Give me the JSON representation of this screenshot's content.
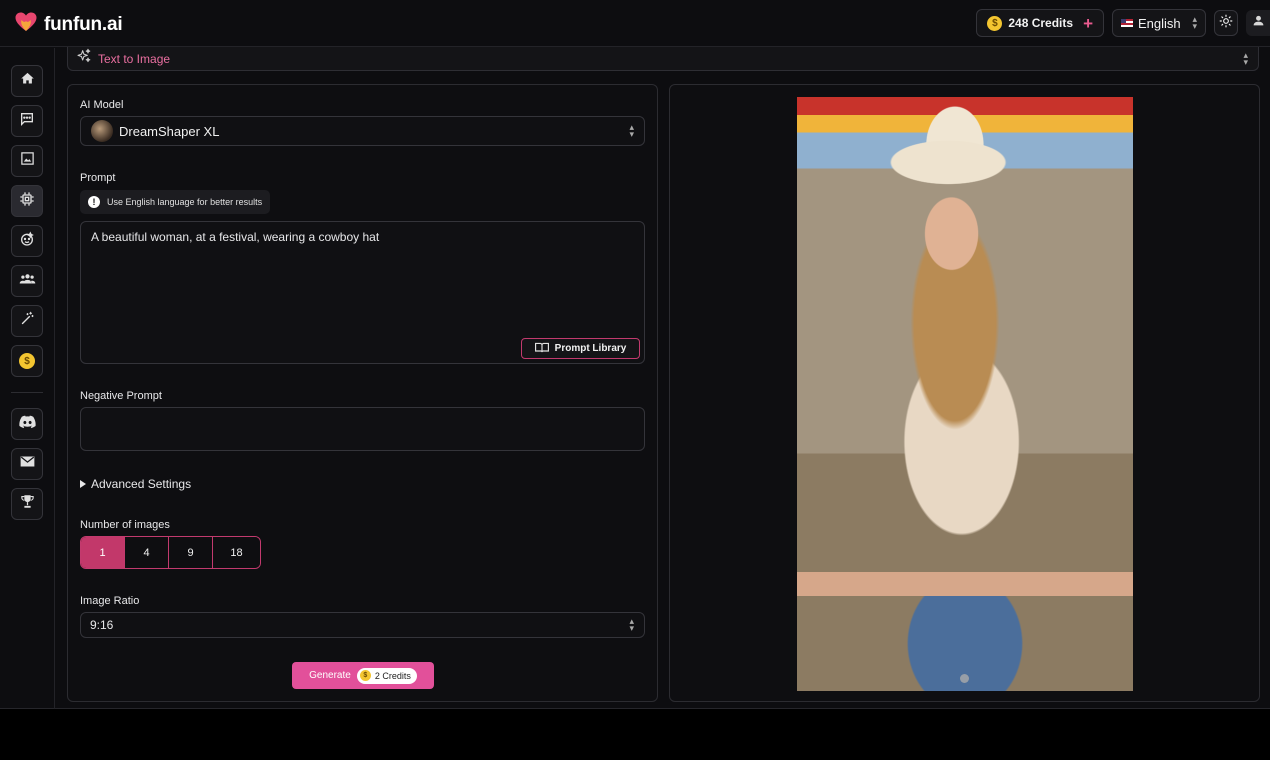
{
  "header": {
    "logo_text": "funfun.ai",
    "credits_label": "248 Credits",
    "language": "English",
    "icons": [
      "heart-logo-icon",
      "coin-icon",
      "plus-icon",
      "us-flag-icon",
      "chevron-updown-icon",
      "sun-icon",
      "user-icon"
    ]
  },
  "sidebar": {
    "items": [
      {
        "name": "home",
        "icon": "home-icon"
      },
      {
        "name": "chat",
        "icon": "chat-icon"
      },
      {
        "name": "image",
        "icon": "image-icon"
      },
      {
        "name": "ai-chip",
        "icon": "chip-icon",
        "active": true
      },
      {
        "name": "face",
        "icon": "face-icon"
      },
      {
        "name": "community",
        "icon": "group-icon"
      },
      {
        "name": "magic",
        "icon": "magic-wand-icon"
      },
      {
        "name": "credits",
        "icon": "dollar-coin-icon"
      },
      {
        "name": "discord",
        "icon": "discord-icon"
      },
      {
        "name": "mail",
        "icon": "mail-icon"
      },
      {
        "name": "trophy",
        "icon": "trophy-icon"
      }
    ]
  },
  "tool_select": {
    "label": "Text to Image"
  },
  "form": {
    "model_label": "AI Model",
    "model_value": "DreamShaper XL",
    "prompt_label": "Prompt",
    "prompt_hint": "Use English language for better results",
    "prompt_value": "A beautiful woman, at a festival, wearing a cowboy hat",
    "prompt_library_label": "Prompt Library",
    "negative_prompt_label": "Negative Prompt",
    "negative_prompt_value": "",
    "advanced_settings_label": "Advanced Settings",
    "num_images_label": "Number of images",
    "num_images_options": [
      "1",
      "4",
      "9",
      "18"
    ],
    "num_images_selected": "1",
    "ratio_label": "Image Ratio",
    "ratio_value": "9:16",
    "generate_label": "Generate",
    "generate_cost": "2 Credits"
  },
  "colors": {
    "accent": "#e2509a",
    "accent_border": "#c23a6e",
    "tool_label": "#e96fa0",
    "background": "#0d0d10",
    "coin": "#f3c530"
  }
}
